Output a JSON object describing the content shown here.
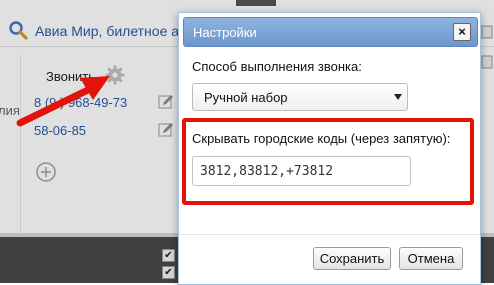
{
  "background": {
    "company_name": "Авиа Мир, билетное аген",
    "call_label": "Звонить",
    "left_fragment": "лия",
    "phones": [
      "8 (9 ) 968-49-73",
      "58-06-85"
    ]
  },
  "dialog": {
    "title": "Настройки",
    "close_label": "×",
    "call_method_label": "Способ выполнения звонка:",
    "call_method_value": "Ручной набор",
    "hide_codes_label": "Скрывать городские коды (через запятую):",
    "hide_codes_value": "3812,83812,+73812",
    "save_label": "Сохранить",
    "cancel_label": "Отмена"
  },
  "colors": {
    "header_gradient_top": "#8fb4df",
    "header_gradient_bottom": "#6d96cc",
    "highlight_red": "#e3120b",
    "link_blue": "#2a5aa8"
  },
  "icons": {
    "search": "search-icon",
    "gear": "gear-icon",
    "edit": "edit-icon",
    "add": "plus-circle-icon",
    "close": "close-icon",
    "caret": "chevron-down-icon"
  }
}
